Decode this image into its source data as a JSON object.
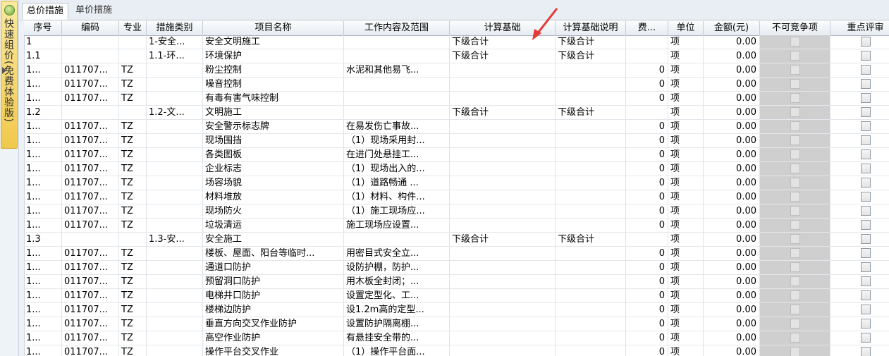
{
  "sidebar": {
    "label": "快速组价(免费体验版)",
    "icon": "globe-icon"
  },
  "tabs": [
    {
      "label": "总价措施",
      "active": true
    },
    {
      "label": "单价措施",
      "active": false
    }
  ],
  "columns": [
    "序号",
    "编码",
    "专业",
    "措施类别",
    "项目名称",
    "工作内容及范围",
    "计算基础",
    "计算基础说明",
    "费...",
    "单位",
    "金额(元)",
    "不可竞争项",
    "重点评审"
  ],
  "rows": [
    [
      "1",
      "",
      "",
      "1-安全...",
      "安全文明施工",
      "",
      "下级合计",
      "下级合计",
      "",
      "项",
      "0.00",
      "",
      ""
    ],
    [
      "1.1",
      "",
      "",
      "1.1-环...",
      "环境保护",
      "",
      "下级合计",
      "下级合计",
      "",
      "项",
      "0.00",
      "",
      ""
    ],
    [
      "1...",
      "011707...",
      "TZ",
      "",
      "粉尘控制",
      "水泥和其他易飞...",
      "",
      "",
      "0",
      "项",
      "0.00",
      "",
      ""
    ],
    [
      "1...",
      "011707...",
      "TZ",
      "",
      "噪音控制",
      "",
      "",
      "",
      "0",
      "项",
      "0.00",
      "",
      ""
    ],
    [
      "1...",
      "011707...",
      "TZ",
      "",
      "有毒有害气味控制",
      "",
      "",
      "",
      "0",
      "项",
      "0.00",
      "",
      ""
    ],
    [
      "1.2",
      "",
      "",
      "1.2-文...",
      "文明施工",
      "",
      "下级合计",
      "下级合计",
      "",
      "项",
      "0.00",
      "",
      ""
    ],
    [
      "1...",
      "011707...",
      "TZ",
      "",
      "安全警示标志牌",
      "在易发伤亡事故...",
      "",
      "",
      "0",
      "项",
      "0.00",
      "",
      ""
    ],
    [
      "1...",
      "011707...",
      "TZ",
      "",
      "现场围挡",
      "（1）现场采用封...",
      "",
      "",
      "0",
      "项",
      "0.00",
      "",
      ""
    ],
    [
      "1...",
      "011707...",
      "TZ",
      "",
      "各类图板",
      "在进门处悬挂工...",
      "",
      "",
      "0",
      "项",
      "0.00",
      "",
      ""
    ],
    [
      "1...",
      "011707...",
      "TZ",
      "",
      "企业标志",
      "（1）现场出入的...",
      "",
      "",
      "0",
      "项",
      "0.00",
      "",
      ""
    ],
    [
      "1...",
      "011707...",
      "TZ",
      "",
      "场容场貌",
      "（1）道路畅通 ...",
      "",
      "",
      "0",
      "项",
      "0.00",
      "",
      ""
    ],
    [
      "1...",
      "011707...",
      "TZ",
      "",
      "材料堆放",
      "（1）材料、构件...",
      "",
      "",
      "0",
      "项",
      "0.00",
      "",
      ""
    ],
    [
      "1...",
      "011707...",
      "TZ",
      "",
      "现场防火",
      "（1）施工现场应...",
      "",
      "",
      "0",
      "项",
      "0.00",
      "",
      ""
    ],
    [
      "1...",
      "011707...",
      "TZ",
      "",
      "垃圾清运",
      "施工现场应设置...",
      "",
      "",
      "0",
      "项",
      "0.00",
      "",
      ""
    ],
    [
      "1.3",
      "",
      "",
      "1.3-安...",
      "安全施工",
      "",
      "下级合计",
      "下级合计",
      "",
      "项",
      "0.00",
      "",
      ""
    ],
    [
      "1...",
      "011707...",
      "TZ",
      "",
      "楼板、屋面、阳台等临时...",
      "用密目式安全立...",
      "",
      "",
      "0",
      "项",
      "0.00",
      "",
      ""
    ],
    [
      "1...",
      "011707...",
      "TZ",
      "",
      "通道口防护",
      "设防护棚，防护...",
      "",
      "",
      "0",
      "项",
      "0.00",
      "",
      ""
    ],
    [
      "1...",
      "011707...",
      "TZ",
      "",
      "预留洞口防护",
      "用木板全封闭；...",
      "",
      "",
      "0",
      "项",
      "0.00",
      "",
      ""
    ],
    [
      "1...",
      "011707...",
      "TZ",
      "",
      "电梯井口防护",
      "设置定型化、工...",
      "",
      "",
      "0",
      "项",
      "0.00",
      "",
      ""
    ],
    [
      "1...",
      "011707...",
      "TZ",
      "",
      "楼梯边防护",
      "设1.2m高的定型...",
      "",
      "",
      "0",
      "项",
      "0.00",
      "",
      ""
    ],
    [
      "1...",
      "011707...",
      "TZ",
      "",
      "垂直方向交叉作业防护",
      "设置防护隔离棚...",
      "",
      "",
      "0",
      "项",
      "0.00",
      "",
      ""
    ],
    [
      "1...",
      "011707...",
      "TZ",
      "",
      "高空作业防护",
      "有悬挂安全带的...",
      "",
      "",
      "0",
      "项",
      "0.00",
      "",
      ""
    ],
    [
      "1...",
      "011707...",
      "TZ",
      "",
      "操作平台交叉作业",
      "（1）操作平台面...",
      "",
      "",
      "0",
      "项",
      "0.00",
      "",
      ""
    ]
  ],
  "current_row": 2
}
